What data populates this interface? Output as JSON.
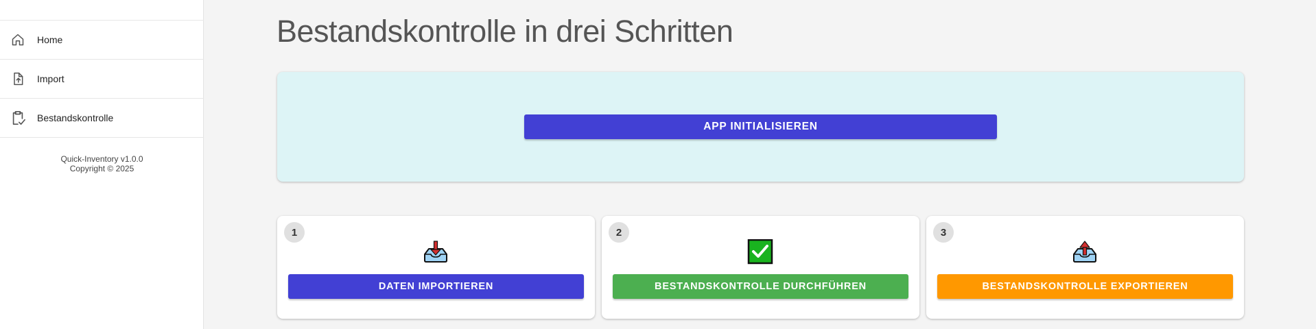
{
  "sidebar": {
    "items": [
      {
        "label": "Home",
        "icon": "home-icon"
      },
      {
        "label": "Import",
        "icon": "file-upload-icon"
      },
      {
        "label": "Bestandskontrolle",
        "icon": "clipboard-check-icon"
      }
    ],
    "footer": {
      "version": "Quick-Inventory v1.0.0",
      "copyright": "Copyright © 2025"
    }
  },
  "main": {
    "title": "Bestandskontrolle in drei Schritten",
    "init_button": "APP INITIALISIEREN",
    "steps": [
      {
        "number": "1",
        "icon": "inbox-tray-icon",
        "button": "DATEN IMPORTIEREN"
      },
      {
        "number": "2",
        "icon": "check-mark-button-icon",
        "button": "BESTANDSKONTROLLE DURCHFÜHREN"
      },
      {
        "number": "3",
        "icon": "outbox-tray-icon",
        "button": "BESTANDSKONTROLLE EXPORTIEREN"
      }
    ]
  },
  "colors": {
    "primary": "#4240d4",
    "success": "#4caf50",
    "warning": "#ff9800",
    "info_panel": "#ddf4f6",
    "accent_blue": "#1565c0"
  }
}
